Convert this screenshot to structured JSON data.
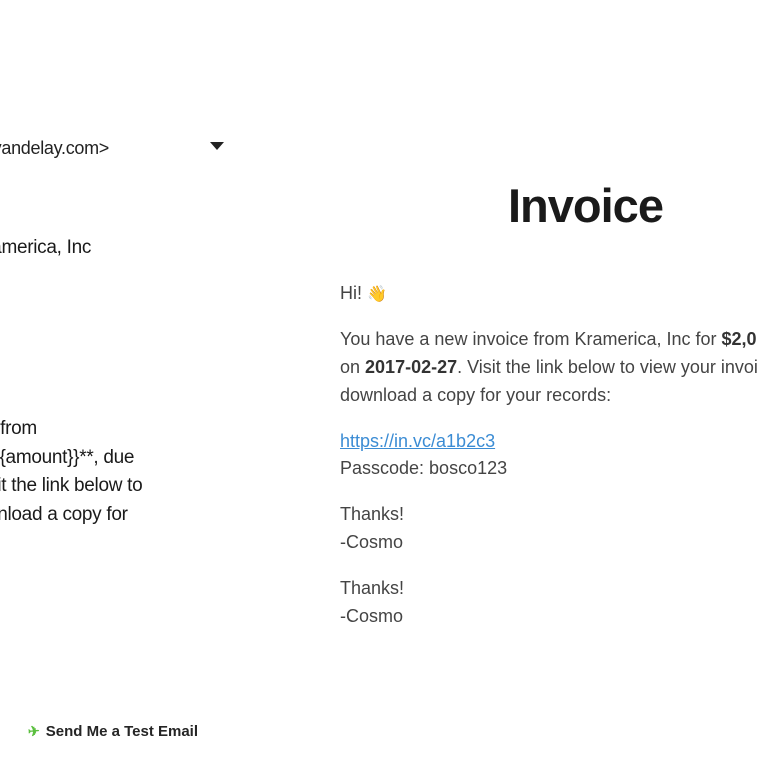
{
  "composer": {
    "from_email": ":@vandelay.com>",
    "subject": "om Kramerica, Inc",
    "template_body": "nvoice from\n} for **{{amount}}**, due\n}**. Visit the link below to\n or download a copy for"
  },
  "actions": {
    "send_test_label": "Send Me a Test Email"
  },
  "preview": {
    "title": "Invoice",
    "greeting": "Hi! ",
    "body_prefix": "You have a new invoice from Kramerica, Inc for ",
    "amount": "$2,0",
    "body_mid": " on ",
    "due_date": "2017-02-27",
    "body_suffix": ". Visit the link below to view your invoi download a copy for your records:",
    "link": "https://in.vc/a1b2c3",
    "passcode_label": "Passcode: bosco123",
    "thanks1": "Thanks!",
    "sig1": "-Cosmo",
    "thanks2": "Thanks!",
    "sig2": "-Cosmo"
  }
}
